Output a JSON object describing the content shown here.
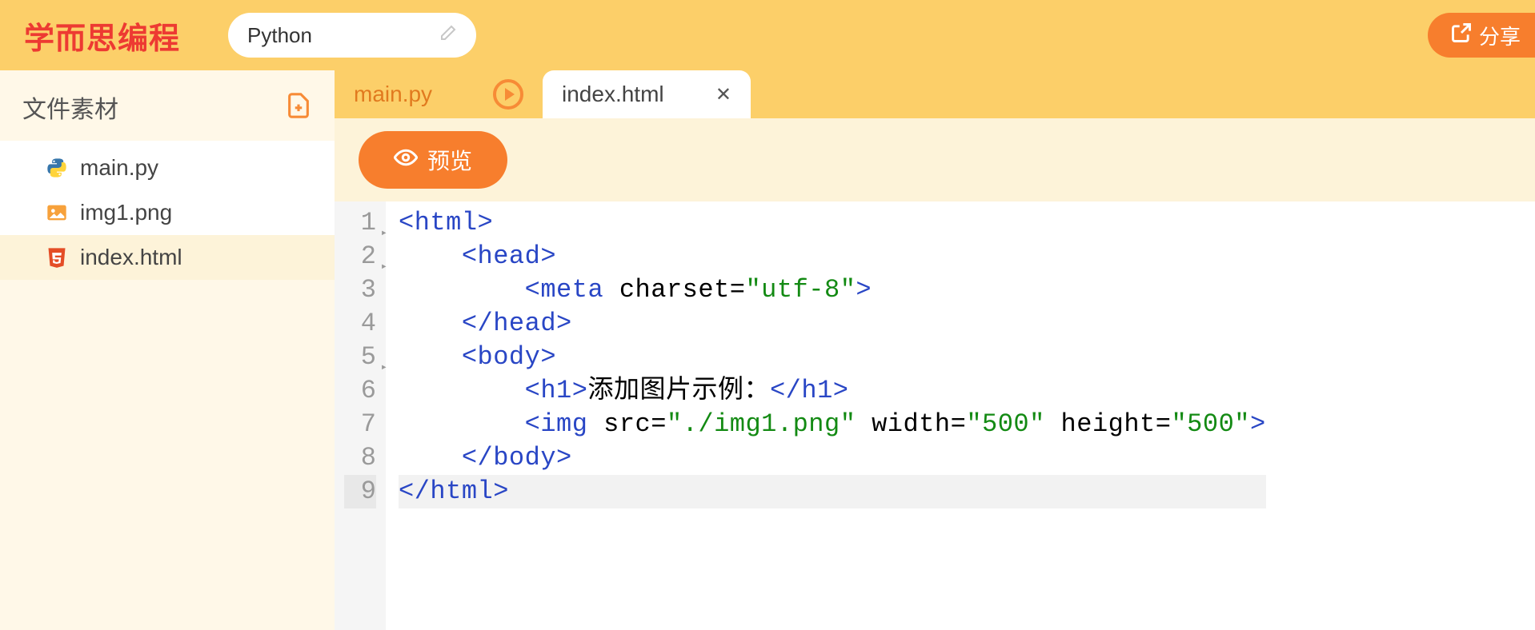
{
  "header": {
    "logo": "学而思编程",
    "project_name": "Python",
    "share_label": "分享"
  },
  "sidebar": {
    "title": "文件素材",
    "files": [
      {
        "name": "main.py",
        "type": "python",
        "selected": false
      },
      {
        "name": "img1.png",
        "type": "image",
        "selected": false
      },
      {
        "name": "index.html",
        "type": "html",
        "selected": true
      }
    ]
  },
  "tabs": [
    {
      "label": "main.py",
      "active": false,
      "runnable": true
    },
    {
      "label": "index.html",
      "active": true,
      "runnable": false
    }
  ],
  "toolbar": {
    "preview_label": "预览"
  },
  "editor": {
    "lines": [
      {
        "n": 1,
        "fold": true,
        "indent": 0,
        "tokens": [
          [
            "tag",
            "<html>"
          ]
        ]
      },
      {
        "n": 2,
        "fold": true,
        "indent": 1,
        "tokens": [
          [
            "tag",
            "<head>"
          ]
        ]
      },
      {
        "n": 3,
        "fold": false,
        "indent": 2,
        "tokens": [
          [
            "tag",
            "<meta"
          ],
          [
            "sp",
            " "
          ],
          [
            "attr",
            "charset"
          ],
          [
            "eq",
            "="
          ],
          [
            "str",
            "\"utf-8\""
          ],
          [
            "tag",
            ">"
          ]
        ]
      },
      {
        "n": 4,
        "fold": false,
        "indent": 1,
        "tokens": [
          [
            "tag",
            "</head>"
          ]
        ]
      },
      {
        "n": 5,
        "fold": true,
        "indent": 1,
        "tokens": [
          [
            "tag",
            "<body>"
          ]
        ]
      },
      {
        "n": 6,
        "fold": false,
        "indent": 2,
        "tokens": [
          [
            "tag",
            "<h1>"
          ],
          [
            "text",
            "添加图片示例："
          ],
          [
            "tag",
            "</h1>"
          ]
        ]
      },
      {
        "n": 7,
        "fold": false,
        "indent": 2,
        "tokens": [
          [
            "tag",
            "<img"
          ],
          [
            "sp",
            " "
          ],
          [
            "attr",
            "src"
          ],
          [
            "eq",
            "="
          ],
          [
            "str",
            "\"./img1.png\""
          ],
          [
            "sp",
            " "
          ],
          [
            "attr",
            "width"
          ],
          [
            "eq",
            "="
          ],
          [
            "str",
            "\"500\""
          ],
          [
            "sp",
            " "
          ],
          [
            "attr",
            "height"
          ],
          [
            "eq",
            "="
          ],
          [
            "str",
            "\"500\""
          ],
          [
            "tag",
            ">"
          ]
        ]
      },
      {
        "n": 8,
        "fold": false,
        "indent": 1,
        "tokens": [
          [
            "tag",
            "</body>"
          ]
        ]
      },
      {
        "n": 9,
        "fold": false,
        "indent": 0,
        "hl": true,
        "tokens": [
          [
            "tag",
            "</html>"
          ]
        ]
      }
    ]
  }
}
